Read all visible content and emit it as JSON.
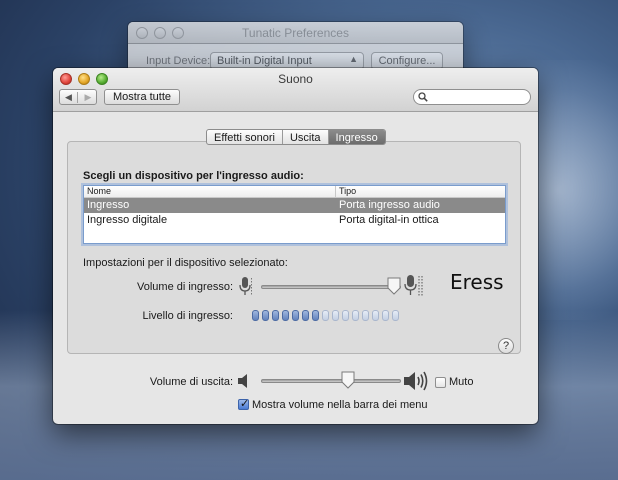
{
  "background_window": {
    "title": "Tunatic Preferences",
    "input_device_label": "Input Device:",
    "input_device_value": "Built-in Digital Input",
    "configure_label": "Configure..."
  },
  "window": {
    "title": "Suono",
    "show_all_label": "Mostra tutte",
    "search_placeholder": ""
  },
  "tabs": [
    {
      "label": "Effetti sonori",
      "active": false
    },
    {
      "label": "Uscita",
      "active": false
    },
    {
      "label": "Ingresso",
      "active": true
    }
  ],
  "input": {
    "heading": "Scegli un dispositivo per l'ingresso audio:",
    "table": {
      "columns": [
        "Nome",
        "Tipo"
      ],
      "rows": [
        {
          "name": "Ingresso",
          "type": "Porta ingresso audio",
          "selected": true
        },
        {
          "name": "Ingresso digitale",
          "type": "Porta digital-in ottica",
          "selected": false
        }
      ]
    },
    "settings_label": "Impostazioni per il dispositivo selezionato:",
    "volume_label": "Volume di ingresso:",
    "volume_value": 0.95,
    "level_label": "Livello di ingresso:",
    "level_segments_total": 15,
    "level_segments_lit": 7,
    "overlay_text": "Eress"
  },
  "output": {
    "volume_label": "Volume di uscita:",
    "volume_value": 0.62,
    "mute_label": "Muto",
    "mute_checked": false,
    "show_menu_label": "Mostra volume nella barra dei menu",
    "show_menu_checked": true
  },
  "help_symbol": "?",
  "colors": {
    "selection_row": "#8a8a8a",
    "level_on": "#6282bd",
    "level_off": "#c3cfe3"
  }
}
